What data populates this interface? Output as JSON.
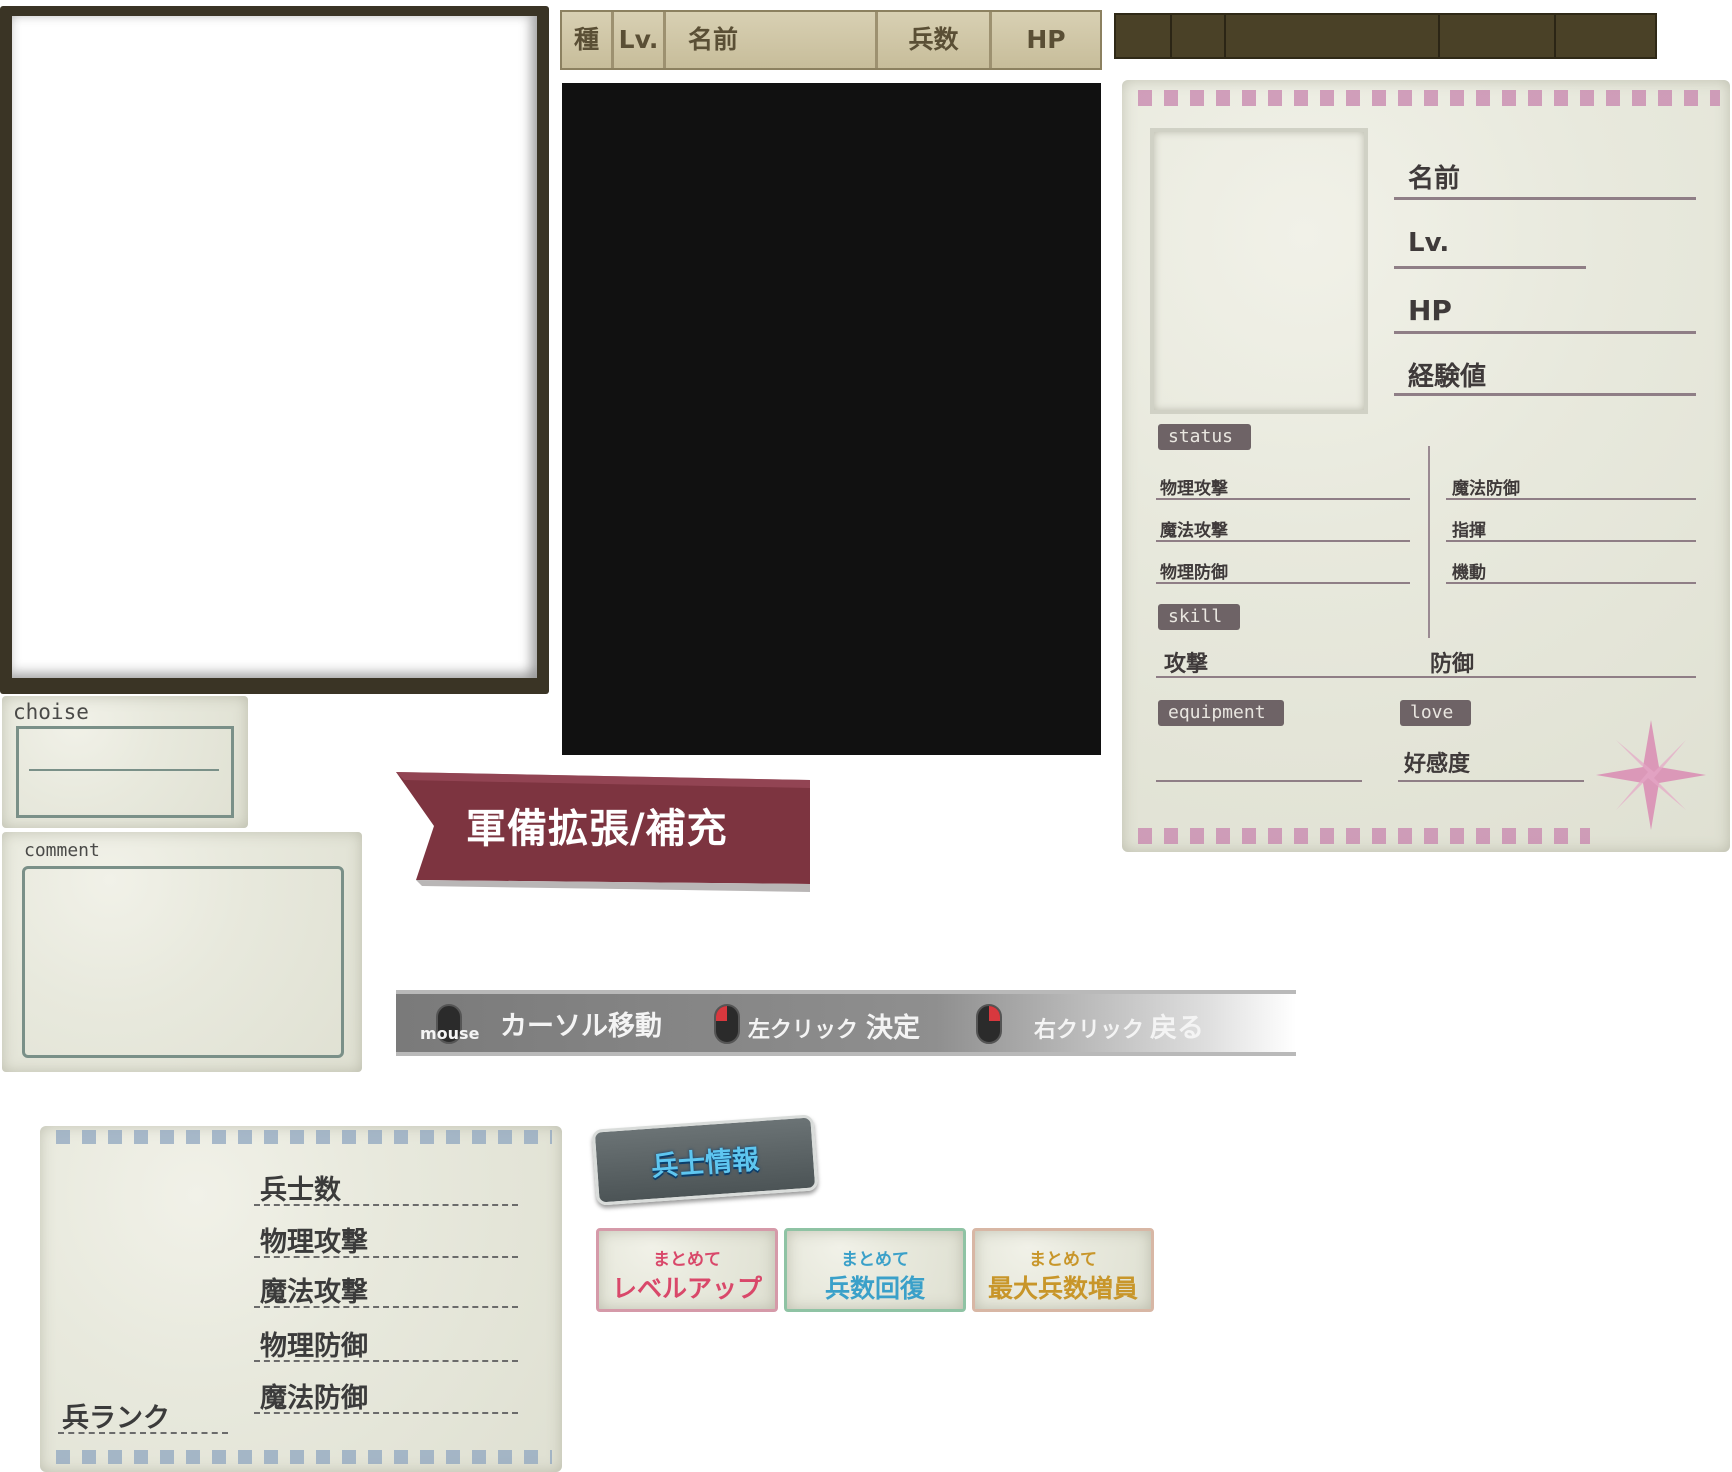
{
  "list_header": {
    "kind": "種",
    "level": "Lv.",
    "name": "名前",
    "troops": "兵数",
    "hp": "HP"
  },
  "status_card": {
    "name": "名前",
    "level": "Lv.",
    "hp": "HP",
    "exp": "経験値",
    "status_tag": "status",
    "status_left": [
      "物理攻撃",
      "魔法攻撃",
      "物理防御"
    ],
    "status_right": [
      "魔法防御",
      "指揮",
      "機動"
    ],
    "skill_tag": "skill",
    "skill_attack": "攻撃",
    "skill_defense": "防御",
    "equipment_tag": "equipment",
    "love_tag": "love",
    "affection": "好感度"
  },
  "choise_panel": {
    "title": "choise"
  },
  "comment_panel": {
    "title": "comment"
  },
  "banner": {
    "title": "軍備拡張/補充",
    "color": "#7d3440"
  },
  "help_bar": {
    "mouse": "mouse",
    "cursor": "カーソル移動",
    "left_click": "左クリック",
    "decide": "決定",
    "right_click": "右クリック",
    "back": "戻る"
  },
  "soldier_card": {
    "rows": [
      "兵士数",
      "物理攻撃",
      "魔法攻撃",
      "物理防御",
      "魔法防御"
    ],
    "rank": "兵ランク"
  },
  "info_tab": {
    "label": "兵士情報"
  },
  "bulk_buttons": [
    {
      "small": "まとめて",
      "big": "レベルアップ",
      "color": "#d9486a"
    },
    {
      "small": "まとめて",
      "big": "兵数回復",
      "color": "#3aa0c9"
    },
    {
      "small": "まとめて",
      "big": "最大兵数増員",
      "color": "#e0b33a"
    }
  ]
}
